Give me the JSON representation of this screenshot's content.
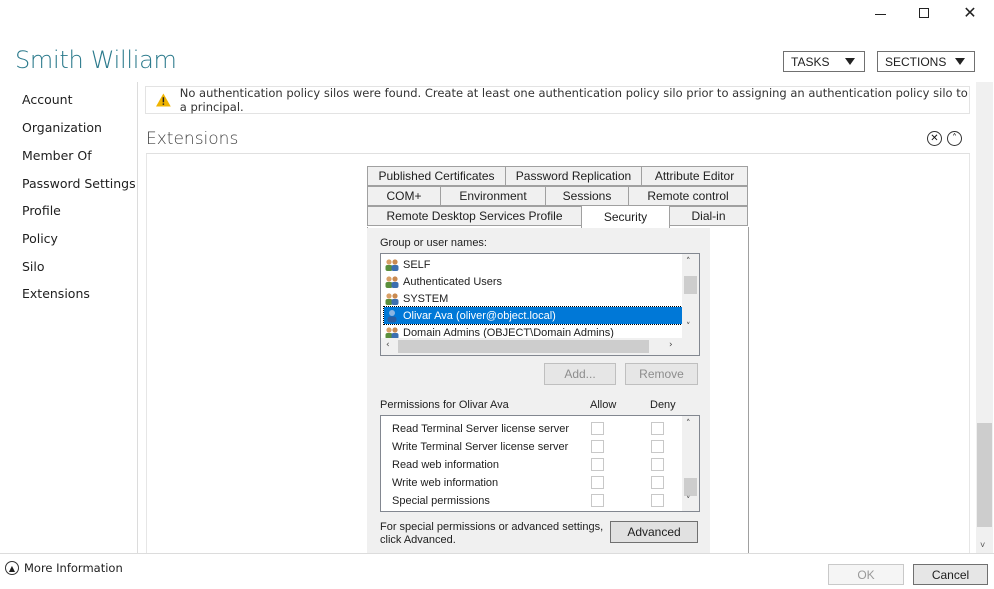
{
  "window": {
    "minimize_icon": "minimize-icon",
    "maximize_icon": "maximize-icon",
    "close_icon": "close-icon"
  },
  "header": {
    "title": "Smith William",
    "tasks_label": "TASKS",
    "sections_label": "SECTIONS"
  },
  "nav": {
    "items": [
      {
        "label": "Account"
      },
      {
        "label": "Organization"
      },
      {
        "label": "Member Of"
      },
      {
        "label": "Password Settings"
      },
      {
        "label": "Profile"
      },
      {
        "label": "Policy"
      },
      {
        "label": "Silo"
      },
      {
        "label": "Extensions"
      }
    ]
  },
  "warning": {
    "text": "No authentication policy silos were found. Create at least one authentication policy silo prior to assigning an authentication policy silo to a principal.",
    "icon": "warning-icon",
    "color": "#e8a000"
  },
  "extensions": {
    "title": "Extensions"
  },
  "tabs": {
    "row1": [
      "Published Certificates",
      "Password Replication",
      "Attribute Editor"
    ],
    "row2": [
      "COM+",
      "Environment",
      "Sessions",
      "Remote control"
    ],
    "row3": [
      "Remote Desktop Services Profile",
      "Security",
      "Dial-in"
    ],
    "active": "Security"
  },
  "security": {
    "group_label": "Group or user names:",
    "users": [
      {
        "name": "SELF",
        "selected": false
      },
      {
        "name": "Authenticated Users",
        "selected": false
      },
      {
        "name": "SYSTEM",
        "selected": false
      },
      {
        "name": "Olivar Ava (oliver@object.local)",
        "selected": true
      },
      {
        "name": "Domain Admins (OBJECT\\Domain Admins)",
        "selected": false
      }
    ],
    "add_label": "Add...",
    "remove_label": "Remove",
    "permissions_label": "Permissions for Olivar Ava",
    "allow_label": "Allow",
    "deny_label": "Deny",
    "permissions": [
      {
        "name": "Read Terminal Server license server",
        "allow": false,
        "deny": false
      },
      {
        "name": "Write Terminal Server license server",
        "allow": false,
        "deny": false
      },
      {
        "name": "Read web information",
        "allow": false,
        "deny": false
      },
      {
        "name": "Write web information",
        "allow": false,
        "deny": false
      },
      {
        "name": "Special permissions",
        "allow": false,
        "deny": false
      }
    ],
    "advanced_text_line1": "For special permissions or advanced settings,",
    "advanced_text_line2": "click Advanced.",
    "advanced_label": "Advanced",
    "selection_color": "#0078d7"
  },
  "footer": {
    "more_info": "More Information",
    "ok_label": "OK",
    "cancel_label": "Cancel"
  }
}
